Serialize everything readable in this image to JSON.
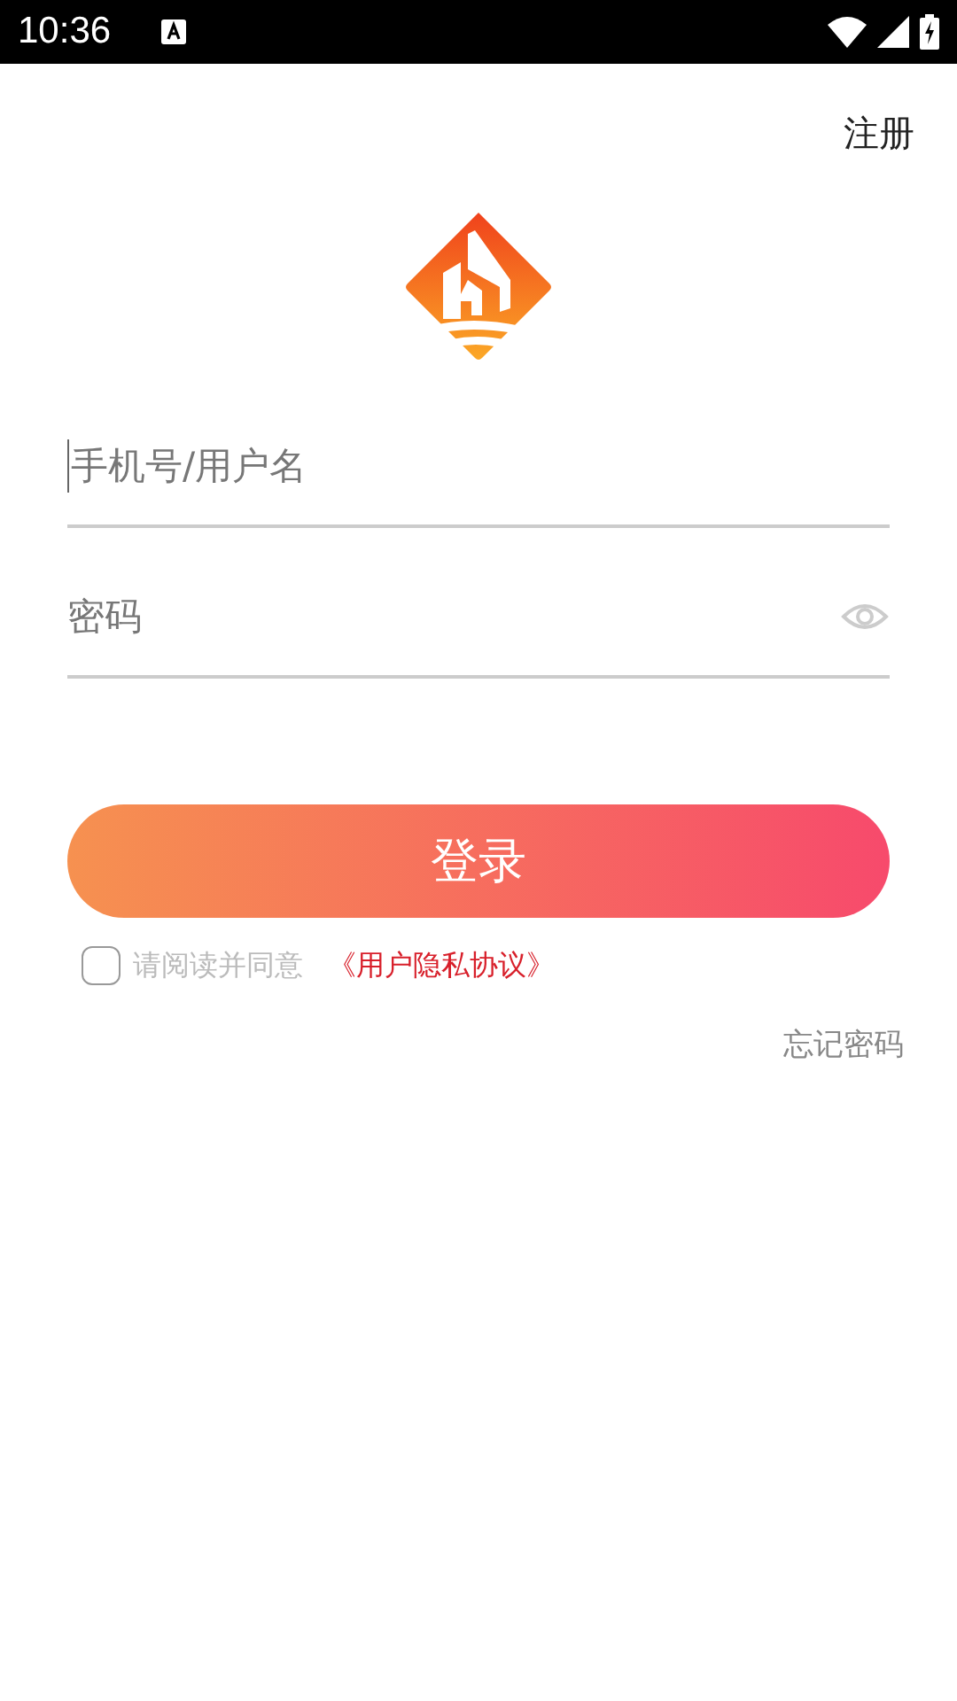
{
  "status_bar": {
    "time": "10:36"
  },
  "header": {
    "register_link": "注册"
  },
  "form": {
    "username": {
      "placeholder": "手机号/用户名",
      "focused": true
    },
    "password": {
      "placeholder": "密码"
    },
    "login_button": "登录",
    "agreement": {
      "checked": false,
      "text": "请阅读并同意",
      "link": "《用户隐私协议》"
    },
    "forgot_password": "忘记密码"
  }
}
